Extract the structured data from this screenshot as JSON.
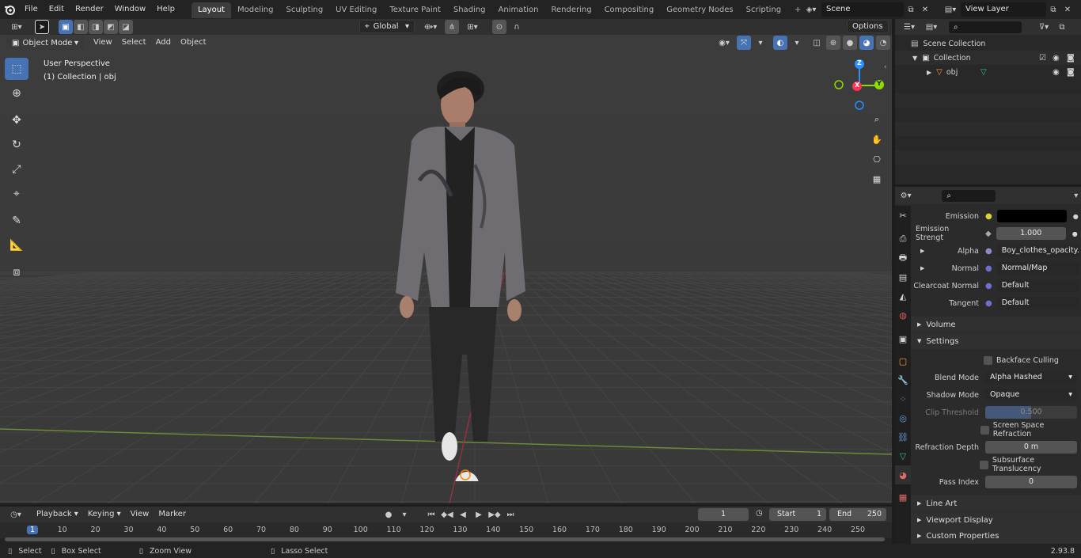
{
  "menus": [
    "File",
    "Edit",
    "Render",
    "Window",
    "Help"
  ],
  "workspaces": [
    "Layout",
    "Modeling",
    "Sculpting",
    "UV Editing",
    "Texture Paint",
    "Shading",
    "Animation",
    "Rendering",
    "Compositing",
    "Geometry Nodes",
    "Scripting"
  ],
  "scene": "Scene",
  "view_layer": "View Layer",
  "transform_orientation": "Global",
  "options_label": "Options",
  "viewport": {
    "mode": "Object Mode",
    "menus": [
      "View",
      "Select",
      "Add",
      "Object"
    ],
    "overlay_title": "User Perspective",
    "overlay_sub": "(1) Collection | obj",
    "gizmo": {
      "z": "Z",
      "y": "Y",
      "x": "X"
    }
  },
  "outliner": {
    "scene_collection": "Scene Collection",
    "collection": "Collection",
    "object": "obj"
  },
  "properties": {
    "emission_label": "Emission",
    "emission_strength_label": "Emission Strengt",
    "emission_strength_value": "1.000",
    "alpha_label": "Alpha",
    "alpha_value": "Boy_clothes_opacity...",
    "normal_label": "Normal",
    "normal_value": "Normal/Map",
    "clearcoat_label": "Clearcoat Normal",
    "clearcoat_value": "Default",
    "tangent_label": "Tangent",
    "tangent_value": "Default",
    "volume": "Volume",
    "settings": "Settings",
    "backface_culling": "Backface Culling",
    "blend_mode_label": "Blend Mode",
    "blend_mode_value": "Alpha Hashed",
    "shadow_mode_label": "Shadow Mode",
    "shadow_mode_value": "Opaque",
    "clip_threshold_label": "Clip Threshold",
    "clip_threshold_value": "0.500",
    "ssr": "Screen Space Refraction",
    "refraction_depth_label": "Refraction Depth",
    "refraction_depth_value": "0 m",
    "subsurface": "Subsurface Translucency",
    "pass_index_label": "Pass Index",
    "pass_index_value": "0",
    "line_art": "Line Art",
    "viewport_display": "Viewport Display",
    "custom_properties": "Custom Properties"
  },
  "timeline": {
    "menus": [
      "Playback",
      "Keying",
      "View",
      "Marker"
    ],
    "current_frame": "1",
    "start_label": "Start",
    "start_value": "1",
    "end_label": "End",
    "end_value": "250",
    "ruler": [
      "1",
      "10",
      "20",
      "30",
      "40",
      "50",
      "60",
      "70",
      "80",
      "90",
      "100",
      "110",
      "120",
      "130",
      "140",
      "150",
      "160",
      "170",
      "180",
      "190",
      "200",
      "210",
      "220",
      "230",
      "240",
      "250"
    ]
  },
  "status": {
    "select": "Select",
    "box_select": "Box Select",
    "zoom_view": "Zoom View",
    "lasso_select": "Lasso Select",
    "version": "2.93.8"
  },
  "colors": {
    "accent": "#4772b3",
    "x_axis": "#ff3352",
    "y_axis": "#8bdc00",
    "z_axis": "#2890ff"
  }
}
